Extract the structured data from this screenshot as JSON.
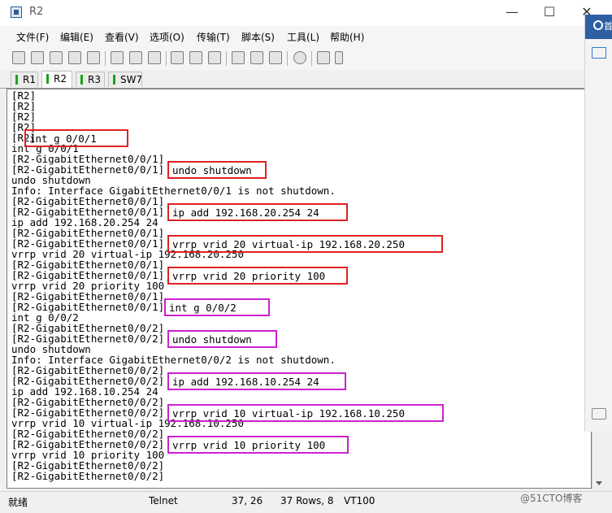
{
  "window": {
    "title": "R2",
    "controls": {
      "minimize": "—",
      "maximize": "☐",
      "close": "✕"
    }
  },
  "menu": [
    "文件(F)",
    "编辑(E)",
    "查看(V)",
    "选项(O)",
    "传输(T)",
    "脚本(S)",
    "工具(L)",
    "帮助(H)"
  ],
  "tabs": [
    {
      "label": "R1",
      "active": false
    },
    {
      "label": "R2",
      "active": true
    },
    {
      "label": "R3",
      "active": false
    },
    {
      "label": "SW7",
      "active": false
    }
  ],
  "terminal": {
    "lines": [
      "[R2]",
      "[R2]",
      "[R2]",
      "[R2]",
      "[R2]int g 0/0/1",
      "int g 0/0/1",
      "[R2-GigabitEthernet0/0/1]",
      "[R2-GigabitEthernet0/0/1]undo shutdown",
      "undo shutdown",
      "Info: Interface GigabitEthernet0/0/1 is not shutdown.",
      "[R2-GigabitEthernet0/0/1]",
      "[R2-GigabitEthernet0/0/1]ip add 192.168.20.254 24",
      "ip add 192.168.20.254 24",
      "[R2-GigabitEthernet0/0/1]",
      "[R2-GigabitEthernet0/0/1]vrrp vrid 20 virtual-ip 192.168.20.250",
      "vrrp vrid 20 virtual-ip 192.168.20.250",
      "[R2-GigabitEthernet0/0/1]",
      "[R2-GigabitEthernet0/0/1]vrrp vrid 20 priority 100",
      "vrrp vrid 20 priority 100",
      "[R2-GigabitEthernet0/0/1]",
      "[R2-GigabitEthernet0/0/1]int g 0/0/2",
      "int g 0/0/2",
      "[R2-GigabitEthernet0/0/2]",
      "[R2-GigabitEthernet0/0/2]undo shutdown",
      "undo shutdown",
      "Info: Interface GigabitEthernet0/0/2 is not shutdown.",
      "[R2-GigabitEthernet0/0/2]",
      "[R2-GigabitEthernet0/0/2]ip add 192.168.10.254 24",
      "ip add 192.168.10.254 24",
      "[R2-GigabitEthernet0/0/2]",
      "[R2-GigabitEthernet0/0/2]vrrp vrid 10 virtual-ip 192.168.10.250",
      "vrrp vrid 10 virtual-ip 192.168.10.250",
      "[R2-GigabitEthernet0/0/2]",
      "[R2-GigabitEthernet0/0/2]vrrp vrid 10 priority 100",
      "vrrp vrid 10 priority 100",
      "[R2-GigabitEthernet0/0/2]",
      "[R2-GigabitEthernet0/0/2]"
    ],
    "highlights": [
      {
        "text": "int g 0/0/1",
        "color": "red"
      },
      {
        "text": "undo shutdown",
        "color": "red"
      },
      {
        "text": "ip add 192.168.20.254 24",
        "color": "red"
      },
      {
        "text": "vrrp vrid 20 virtual-ip 192.168.20.250",
        "color": "red"
      },
      {
        "text": "vrrp vrid 20 priority 100",
        "color": "red"
      },
      {
        "text": "int g 0/0/2",
        "color": "pink"
      },
      {
        "text": "undo shutdown",
        "color": "pink"
      },
      {
        "text": "ip add 192.168.10.254 24",
        "color": "pink"
      },
      {
        "text": "vrrp vrid 10 virtual-ip 192.168.10.250",
        "color": "pink"
      },
      {
        "text": "vrrp vrid 10 priority 100",
        "color": "pink"
      }
    ]
  },
  "status": {
    "ready": "就绪",
    "protocol": "Telnet",
    "cursor": "37,  26",
    "rows": "37 Rows,  8",
    "terminal_type": "VT100"
  },
  "side_panel": {
    "label": "首"
  },
  "watermark": "@51CTO博客",
  "colors": {
    "highlight_red": "#e02222",
    "highlight_pink": "#cc22cc",
    "tab_green": "#1aa31a"
  }
}
